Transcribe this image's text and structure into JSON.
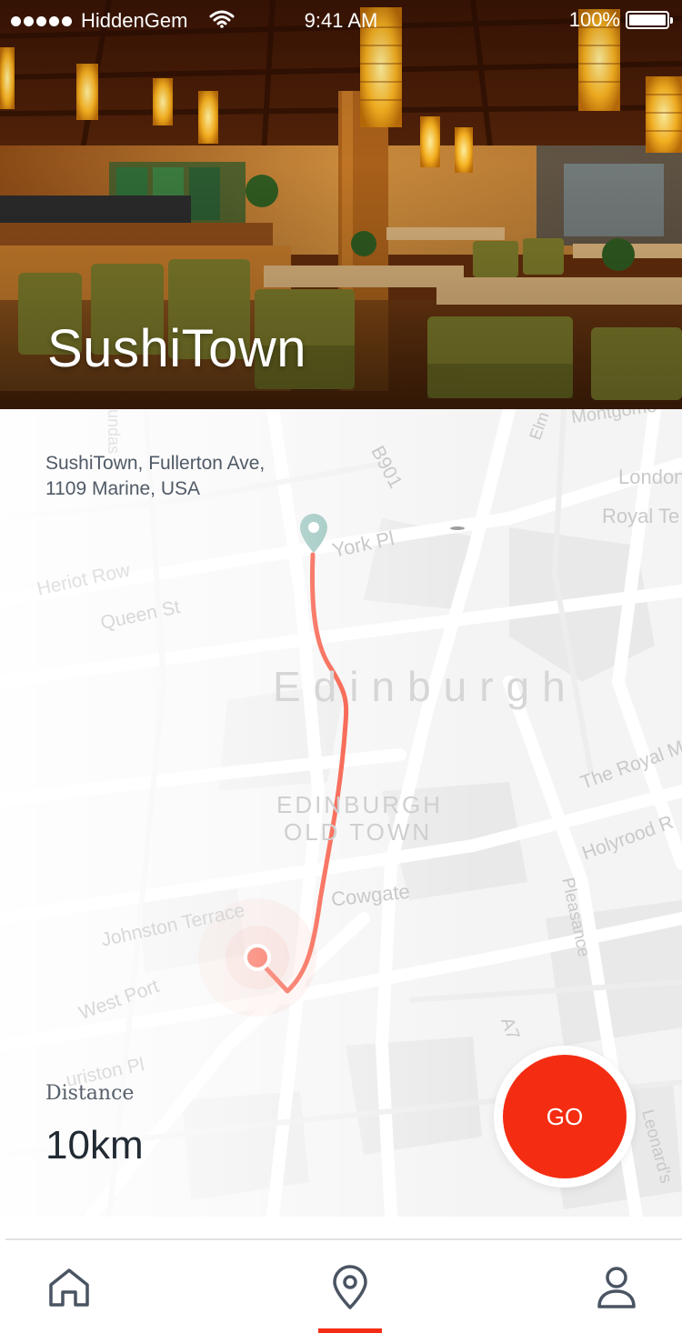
{
  "status_bar": {
    "carrier": "HiddenGem",
    "time": "9:41 AM",
    "battery": "100%",
    "icons": [
      "signal-dots-icon",
      "wifi-icon",
      "battery-icon"
    ]
  },
  "hero": {
    "title": "SushiTown",
    "image": "restaurant-interior-photo"
  },
  "location": {
    "address_line1": "SushiTown, Fullerton Ave,",
    "address_line2": "1109 Marine, USA"
  },
  "map": {
    "labels": {
      "city": "Edinburgh",
      "district_line1": "EDINBURGH",
      "district_line2": "OLD TOWN",
      "york_pl": "York Pl",
      "queen_st": "Queen St",
      "heriot_row": "Heriot Row",
      "b901": "B901",
      "london": "London",
      "royal_te": "Royal Te",
      "montgomery": "Montgome",
      "elm": "Elm",
      "cowgate": "Cowgate",
      "johnston_terrace": "Johnston Terrace",
      "west_port": "West Port",
      "lauriston_pl": "uriston Pl",
      "the_royal_mile": "The Royal M",
      "holyrood": "Holyrood R",
      "pleasance": "Pleasance",
      "a7": "A7",
      "leonards": "Leonard's",
      "lothian": "undas"
    },
    "route_color": "#f42d12",
    "destination_pin_color": "#7fb5ad",
    "origin_marker_color": "#f42d12"
  },
  "distance": {
    "label": "Distance",
    "value": "10km"
  },
  "go_button": {
    "label": "GO"
  },
  "tab_bar": {
    "tabs": [
      {
        "name": "home",
        "icon": "home-icon",
        "active": false
      },
      {
        "name": "map",
        "icon": "location-pin-icon",
        "active": true
      },
      {
        "name": "profile",
        "icon": "user-icon",
        "active": false
      }
    ],
    "active_color": "#f42d12"
  },
  "colors": {
    "accent": "#f42d12",
    "text_dark": "#222a33",
    "text_muted": "#505a66",
    "tab_icon": "#4a5462"
  }
}
